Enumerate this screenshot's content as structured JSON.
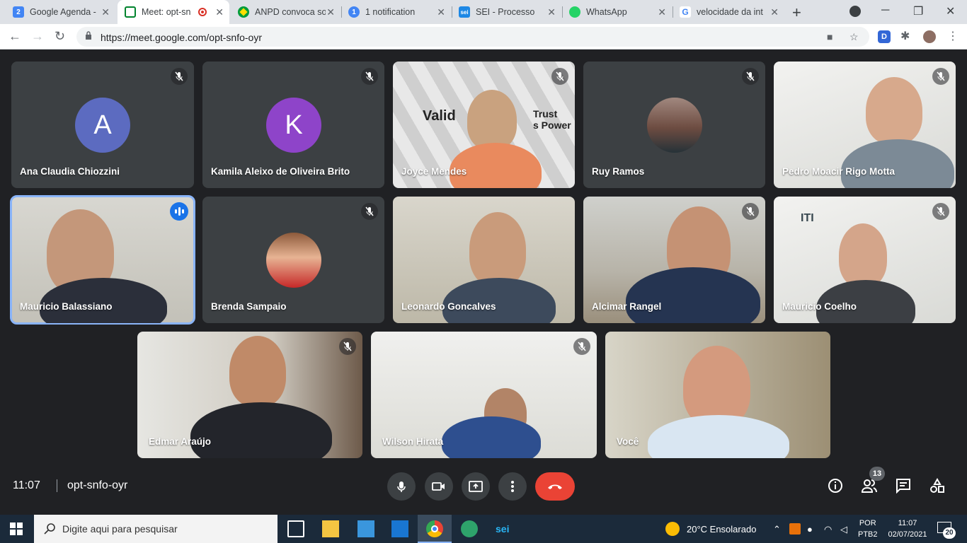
{
  "browser": {
    "tabs": [
      {
        "title": "Google Agenda -",
        "favicon": "calendar-icon",
        "color": "#4285f4",
        "glyph": "2"
      },
      {
        "title": "Meet: opt-sn",
        "favicon": "meet-icon",
        "color": "#00832d",
        "glyph": ""
      },
      {
        "title": "ANPD convoca so",
        "favicon": "brazil-flag-icon",
        "color": "#009c3b",
        "glyph": ""
      },
      {
        "title": "1 notification",
        "favicon": "notification-icon",
        "color": "#1a73e8",
        "glyph": "1"
      },
      {
        "title": "SEI - Processo",
        "favicon": "sei-icon",
        "color": "#1e88e5",
        "glyph": "sei"
      },
      {
        "title": "WhatsApp",
        "favicon": "whatsapp-icon",
        "color": "#25d366",
        "glyph": ""
      },
      {
        "title": "velocidade da int",
        "favicon": "google-icon",
        "color": "#ffffff",
        "glyph": "G"
      }
    ],
    "url": "https://meet.google.com/opt-snfo-oyr",
    "profile_initial": "D"
  },
  "meet": {
    "participants": [
      {
        "name": "Ana Claudia Chiozzini",
        "initial": "A",
        "avatar_color": "#5c6bc0",
        "muted": true
      },
      {
        "name": "Kamila Aleixo de Oliveira Brito",
        "initial": "K",
        "avatar_color": "#8e44c9",
        "muted": true
      },
      {
        "name": "Joyce Mendes",
        "muted": true,
        "bg_text_1": "Valid",
        "bg_text_2": "Trust",
        "bg_text_3": "s Power"
      },
      {
        "name": "Ruy Ramos",
        "muted": true
      },
      {
        "name": "Pedro Moacir Rigo Motta",
        "muted": true
      },
      {
        "name": "Mauricio Balassiano",
        "speaking": true
      },
      {
        "name": "Brenda Sampaio",
        "muted": true
      },
      {
        "name": "Leonardo Goncalves",
        "muted": false
      },
      {
        "name": "Alcimar Rangel",
        "muted": true
      },
      {
        "name": "Mauricio Coelho",
        "muted": true,
        "bg_text": "ITI"
      },
      {
        "name": "Edmar Araújo",
        "muted": true
      },
      {
        "name": "Wilson Hirata",
        "muted": true
      },
      {
        "name": "Você",
        "muted": false
      }
    ],
    "time": "11:07",
    "meeting_code": "opt-snfo-oyr",
    "people_count": "13"
  },
  "taskbar": {
    "search_placeholder": "Digite aqui para pesquisar",
    "weather": "20°C  Ensolarado",
    "lang_1": "POR",
    "lang_2": "PTB2",
    "time": "11:07",
    "date": "02/07/2021",
    "notifications": "20"
  }
}
